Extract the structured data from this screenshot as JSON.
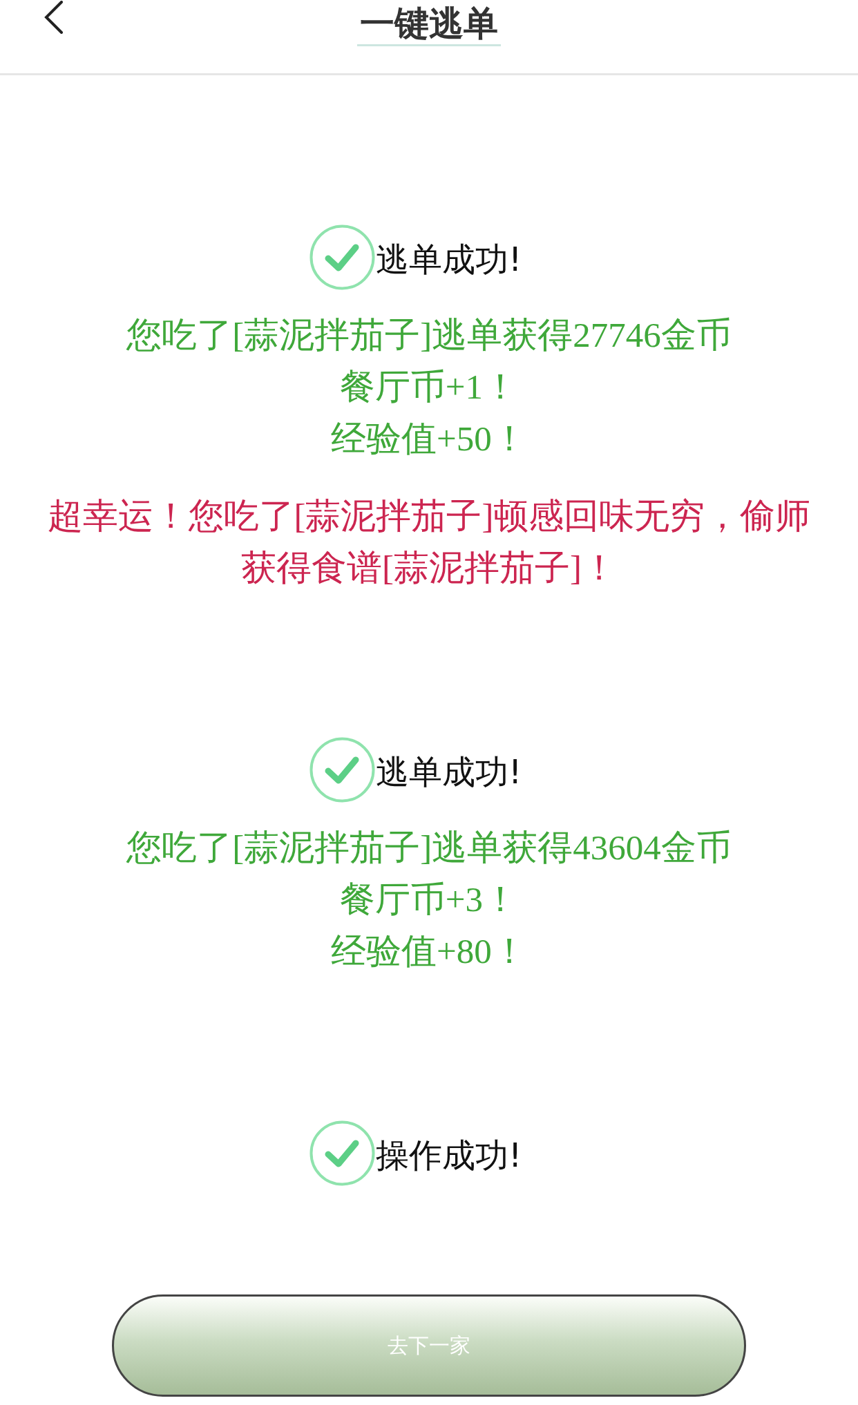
{
  "header": {
    "title": "一键逃单"
  },
  "results": [
    {
      "status": "逃单成功!",
      "messages": [
        {
          "kind": "reward",
          "text": "您吃了[蒜泥拌茄子]逃单获得27746金币"
        },
        {
          "kind": "reward",
          "text": "餐厅币+1！"
        },
        {
          "kind": "reward",
          "text": "经验值+50！"
        },
        {
          "kind": "lucky",
          "text": "超幸运！您吃了[蒜泥拌茄子]顿感回味无穷，偷师获得食谱[蒜泥拌茄子]！"
        }
      ]
    },
    {
      "status": "逃单成功!",
      "messages": [
        {
          "kind": "reward",
          "text": "您吃了[蒜泥拌茄子]逃单获得43604金币"
        },
        {
          "kind": "reward",
          "text": "餐厅币+3！"
        },
        {
          "kind": "reward",
          "text": "经验值+80！"
        }
      ]
    },
    {
      "status": "操作成功!"
    }
  ],
  "button": "去下一家"
}
